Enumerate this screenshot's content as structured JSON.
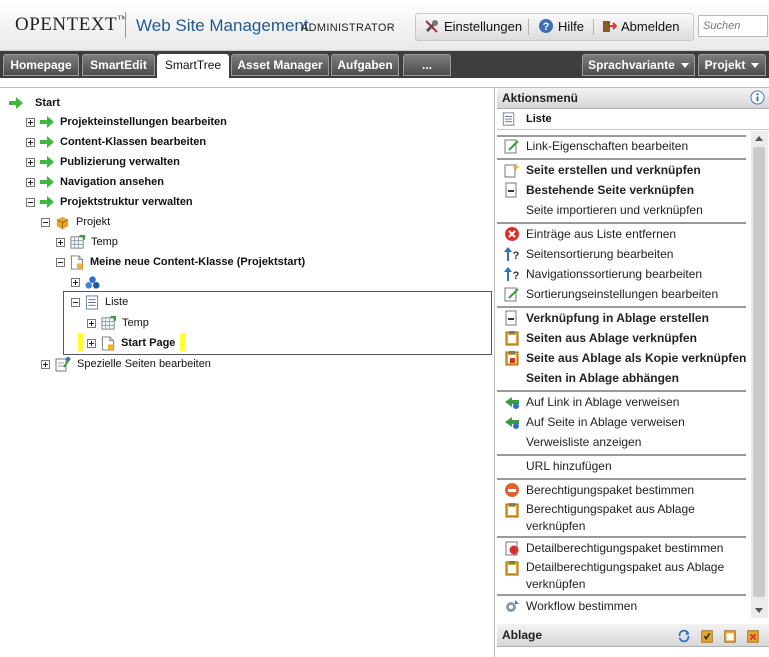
{
  "header": {
    "brand": "OPENTEXT",
    "brand_tm": "™",
    "product": "Web Site Management",
    "role": "ADMINISTRATOR",
    "menu": {
      "settings": "Einstellungen",
      "help": "Hilfe",
      "logout": "Abmelden"
    },
    "search_placeholder": "Suchen"
  },
  "tabs": {
    "homepage": "Homepage",
    "smartedit": "SmartEdit",
    "smarttree": "SmartTree",
    "asset_manager": "Asset Manager",
    "aufgaben": "Aufgaben",
    "more": "...",
    "sprachvariante": "Sprachvariante",
    "projekt": "Projekt"
  },
  "tree": {
    "start": "Start",
    "projekteinstellungen": "Projekteinstellungen bearbeiten",
    "content_klassen": "Content-Klassen bearbeiten",
    "publizierung": "Publizierung verwalten",
    "navigation": "Navigation ansehen",
    "projektstruktur": "Projektstruktur verwalten",
    "projekt": "Projekt",
    "temp": "Temp",
    "content_klasse": "Meine neue Content-Klasse (Projektstart)",
    "liste": "Liste",
    "temp2": "Temp",
    "start_page": "Start Page",
    "spezielle_seiten": "Spezielle Seiten bearbeiten"
  },
  "actions": {
    "title": "Aktionsmenü",
    "context": "Liste",
    "items": [
      "Link-Eigenschaften bearbeiten",
      "Seite erstellen und verknüpfen",
      "Bestehende Seite verknüpfen",
      "Seite importieren und verknüpfen",
      "Einträge aus Liste entfernen",
      "Seitensortierung bearbeiten",
      "Navigationssortierung bearbeiten",
      "Sortierungseinstellungen bearbeiten",
      "Verknüpfung in Ablage erstellen",
      "Seiten aus Ablage verknüpfen",
      "Seite aus Ablage als Kopie verknüpfen",
      "Seiten in Ablage abhängen",
      "Auf Link in Ablage verweisen",
      "Auf Seite in Ablage verweisen",
      "Verweisliste anzeigen",
      "URL hinzufügen",
      "Berechtigungspaket bestimmen",
      "Berechtigungspaket aus Ablage verknüpfen",
      "Detailberechtigungspaket bestimmen",
      "Detailberechtigungspaket aus Ablage verknüpfen",
      "Workflow bestimmen"
    ]
  },
  "ablage": {
    "title": "Ablage"
  }
}
